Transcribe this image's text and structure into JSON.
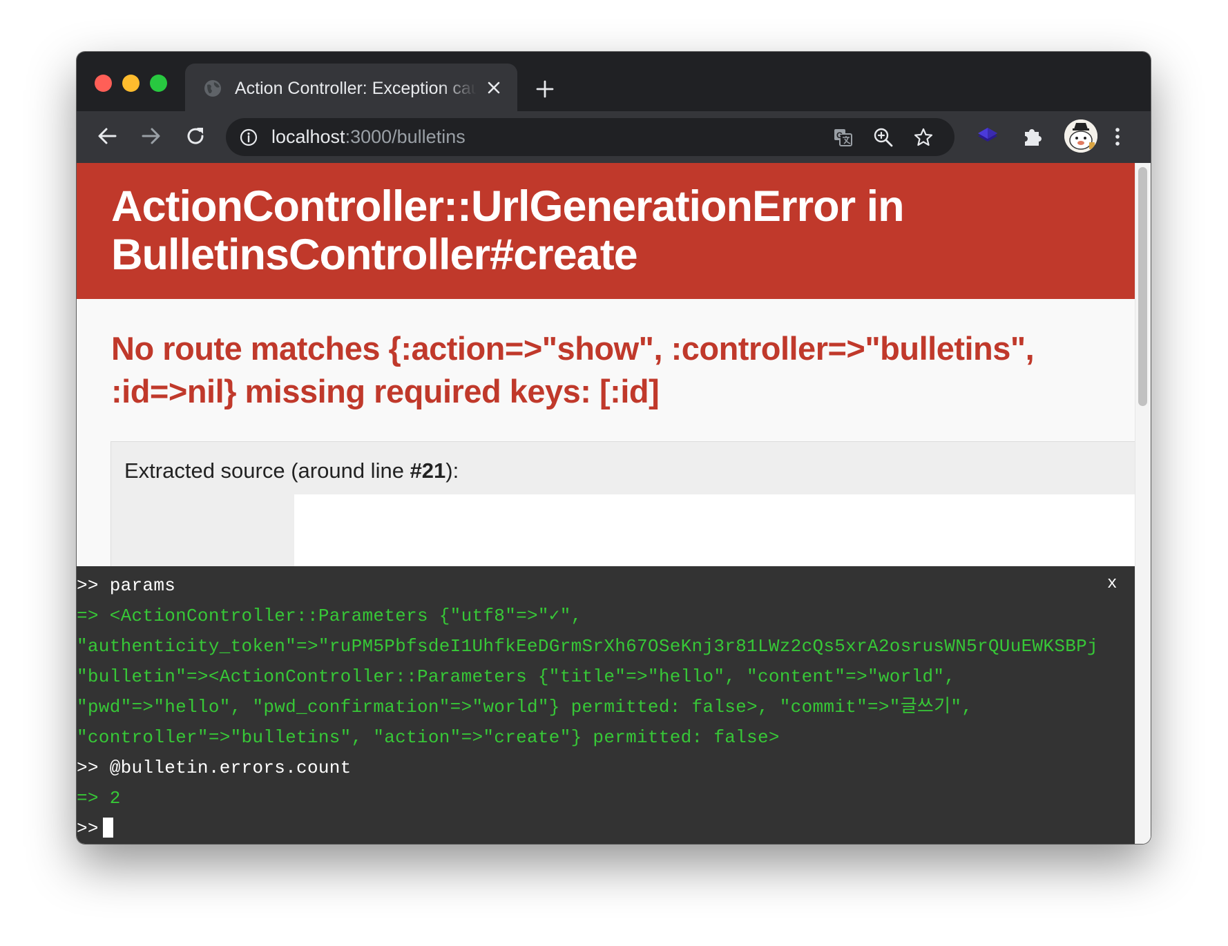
{
  "browser": {
    "tab": {
      "title": "Action Controller: Exception caught",
      "favicon_icon": "globe-icon",
      "close_icon": "close-icon"
    },
    "new_tab_icon": "plus-icon",
    "toolbar": {
      "back_icon": "arrow-left-icon",
      "forward_icon": "arrow-right-icon",
      "reload_icon": "reload-icon",
      "site_info_icon": "info-icon",
      "url_host": "localhost",
      "url_rest": ":3000/bulletins",
      "translate_icon": "translate-icon",
      "zoom_icon": "zoom-in-icon",
      "bookmark_icon": "star-icon",
      "extension_icon": "layers-icon",
      "extensions_menu_icon": "puzzle-icon",
      "profile_icon": "avatar",
      "menu_icon": "more-vert-icon"
    }
  },
  "page": {
    "error_title": "ActionController::UrlGenerationError in BulletinsController#create",
    "error_message": "No route matches {:action=>\"show\", :controller=>\"bulletins\", :id=>nil} missing required keys: [:id]",
    "source_caption_prefix": "Extracted source (around line ",
    "source_caption_line": "#21",
    "source_caption_suffix": "):"
  },
  "console": {
    "close_label": "x",
    "lines": [
      {
        "kind": "input",
        "text": ">> params"
      },
      {
        "kind": "output",
        "text": "=> <ActionController::Parameters {\"utf8\"=>\"✓\","
      },
      {
        "kind": "output",
        "text": "\"authenticity_token\"=>\"ruPM5PbfsdeI1UhfkEeDGrmSrXh67OSeKnj3r81LWz2cQs5xrA2osrusWN5rQUuEWKSBPj"
      },
      {
        "kind": "output",
        "text": "\"bulletin\"=><ActionController::Parameters {\"title\"=>\"hello\", \"content\"=>\"world\","
      },
      {
        "kind": "output",
        "text": "\"pwd\"=>\"hello\", \"pwd_confirmation\"=>\"world\"} permitted: false>, \"commit\"=>\"글쓰기\","
      },
      {
        "kind": "output",
        "text": "\"controller\"=>\"bulletins\", \"action\"=>\"create\"} permitted: false>"
      },
      {
        "kind": "input",
        "text": ">> @bulletin.errors.count"
      },
      {
        "kind": "output",
        "text": "=> 2"
      },
      {
        "kind": "input",
        "text": ">>"
      }
    ]
  },
  "colors": {
    "error_header_bg": "#c0392b",
    "error_message_text": "#c0392b",
    "console_bg": "#333333",
    "console_output_text": "#37c837",
    "browser_chrome_dark": "#202124",
    "browser_toolbar": "#35363a"
  }
}
